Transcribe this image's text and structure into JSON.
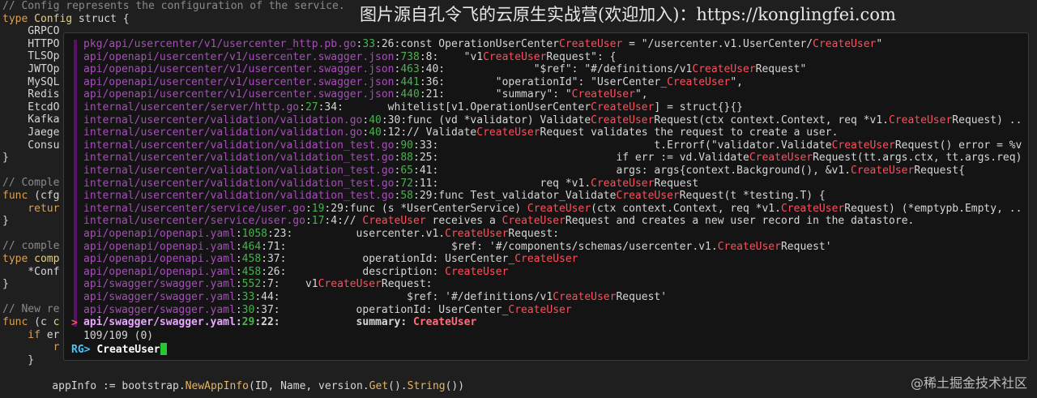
{
  "watermark": "图片源自孔令飞的云原生实战营(欢迎加入)：https://konglingfei.com",
  "corner_watermark": "@稀土掘金技术社区",
  "editor": {
    "lines": [
      [
        [
          "c",
          "// Config represents the configuration of the service."
        ]
      ],
      [
        [
          "k",
          "type "
        ],
        [
          "t",
          "Config"
        ],
        [
          "p",
          " struct {"
        ]
      ],
      [
        [
          "p",
          "    GRPCO"
        ]
      ],
      [
        [
          "p",
          "    HTTPO"
        ]
      ],
      [
        [
          "p",
          "    TLSOp"
        ]
      ],
      [
        [
          "p",
          "    JWTOp"
        ]
      ],
      [
        [
          "p",
          "    MySQL"
        ]
      ],
      [
        [
          "p",
          "    Redis"
        ]
      ],
      [
        [
          "p",
          "    EtcdO"
        ]
      ],
      [
        [
          "p",
          "    Kafka"
        ]
      ],
      [
        [
          "p",
          "    Jaege"
        ]
      ],
      [
        [
          "p",
          "    Consu"
        ]
      ],
      [
        [
          "p",
          "}"
        ]
      ],
      [
        [
          "p",
          ""
        ]
      ],
      [
        [
          "c",
          "// Comple"
        ]
      ],
      [
        [
          "k",
          "func "
        ],
        [
          "p",
          "(cfg"
        ]
      ],
      [
        [
          "k",
          "    retur"
        ]
      ],
      [
        [
          "p",
          "}"
        ]
      ],
      [
        [
          "p",
          ""
        ]
      ],
      [
        [
          "c",
          "// comple"
        ]
      ],
      [
        [
          "k",
          "type "
        ],
        [
          "t",
          "comp"
        ]
      ],
      [
        [
          "p",
          "    *Conf"
        ]
      ],
      [
        [
          "p",
          "}"
        ]
      ],
      [
        [
          "p",
          ""
        ]
      ],
      [
        [
          "c",
          "// New re"
        ]
      ],
      [
        [
          "k",
          "func "
        ],
        [
          "p",
          "(c "
        ],
        [
          "t",
          "c"
        ]
      ],
      [
        [
          "k",
          "    if "
        ],
        [
          "p",
          "er"
        ]
      ],
      [
        [
          "k",
          "        r"
        ]
      ],
      [
        [
          "p",
          "    }"
        ]
      ]
    ],
    "bottom_line": [
      [
        "p",
        "    appInfo := bootstrap."
      ],
      [
        "f",
        "NewAppInfo"
      ],
      [
        "p",
        "(ID, Name, version."
      ],
      [
        "f",
        "Get"
      ],
      [
        "p",
        "()."
      ],
      [
        "f",
        "String"
      ],
      [
        "p",
        "())"
      ]
    ]
  },
  "fzf": {
    "results": [
      [
        [
          "path",
          "pkg/api/usercenter/v1/usercenter_http.pb.go"
        ],
        [
          "p",
          ":"
        ],
        [
          "n",
          "33"
        ],
        [
          "p",
          ":26:const OperationUserCenter"
        ],
        [
          "m",
          "CreateUser"
        ],
        [
          "p",
          " = \"/usercenter.v1.UserCenter/"
        ],
        [
          "m",
          "CreateUser"
        ],
        [
          "p",
          "\""
        ]
      ],
      [
        [
          "path",
          "api/openapi/usercenter/v1/usercenter.swagger.json"
        ],
        [
          "p",
          ":"
        ],
        [
          "n",
          "738"
        ],
        [
          "p",
          ":8:    \"v1"
        ],
        [
          "m",
          "CreateUser"
        ],
        [
          "p",
          "Request\": {"
        ]
      ],
      [
        [
          "path",
          "api/openapi/usercenter/v1/usercenter.swagger.json"
        ],
        [
          "p",
          ":"
        ],
        [
          "n",
          "463"
        ],
        [
          "p",
          ":40:              \"$ref\": \"#/definitions/v1"
        ],
        [
          "m",
          "CreateUser"
        ],
        [
          "p",
          "Request\""
        ]
      ],
      [
        [
          "path",
          "api/openapi/usercenter/v1/usercenter.swagger.json"
        ],
        [
          "p",
          ":"
        ],
        [
          "n",
          "441"
        ],
        [
          "p",
          ":36:        \"operationId\": \"UserCenter_"
        ],
        [
          "m",
          "CreateUser"
        ],
        [
          "p",
          "\","
        ]
      ],
      [
        [
          "path",
          "api/openapi/usercenter/v1/usercenter.swagger.json"
        ],
        [
          "p",
          ":"
        ],
        [
          "n",
          "440"
        ],
        [
          "p",
          ":21:        \"summary\": \""
        ],
        [
          "m",
          "CreateUser"
        ],
        [
          "p",
          "\","
        ]
      ],
      [
        [
          "path",
          "internal/usercenter/server/http.go"
        ],
        [
          "p",
          ":"
        ],
        [
          "n",
          "27"
        ],
        [
          "p",
          ":34:       whitelist[v1.OperationUserCenter"
        ],
        [
          "m",
          "CreateUser"
        ],
        [
          "p",
          "] = struct{}{}"
        ]
      ],
      [
        [
          "path",
          "internal/usercenter/validation/validation.go"
        ],
        [
          "p",
          ":"
        ],
        [
          "n",
          "40"
        ],
        [
          "p",
          ":30:func (vd *validator) Validate"
        ],
        [
          "m",
          "CreateUser"
        ],
        [
          "p",
          "Request(ctx context.Context, req *v1."
        ],
        [
          "m",
          "CreateUser"
        ],
        [
          "p",
          "Request) .."
        ]
      ],
      [
        [
          "path",
          "internal/usercenter/validation/validation.go"
        ],
        [
          "p",
          ":"
        ],
        [
          "n",
          "40"
        ],
        [
          "p",
          ":12:// Validate"
        ],
        [
          "m",
          "CreateUser"
        ],
        [
          "p",
          "Request validates the request to create a user."
        ]
      ],
      [
        [
          "path",
          "internal/usercenter/validation/validation_test.go"
        ],
        [
          "p",
          ":"
        ],
        [
          "n",
          "90"
        ],
        [
          "p",
          ":33:                                  t.Errorf(\"validator.Validate"
        ],
        [
          "m",
          "CreateUser"
        ],
        [
          "p",
          "Request() error = %v.."
        ]
      ],
      [
        [
          "path",
          "internal/usercenter/validation/validation_test.go"
        ],
        [
          "p",
          ":"
        ],
        [
          "n",
          "88"
        ],
        [
          "p",
          ":25:                            if err := vd.Validate"
        ],
        [
          "m",
          "CreateUser"
        ],
        [
          "p",
          "Request(tt.args.ctx, tt.args.req); .."
        ]
      ],
      [
        [
          "path",
          "internal/usercenter/validation/validation_test.go"
        ],
        [
          "p",
          ":"
        ],
        [
          "n",
          "65"
        ],
        [
          "p",
          ":41:                            args: args{context.Background(), &v1."
        ],
        [
          "m",
          "CreateUser"
        ],
        [
          "p",
          "Request{"
        ]
      ],
      [
        [
          "path",
          "internal/usercenter/validation/validation_test.go"
        ],
        [
          "p",
          ":"
        ],
        [
          "n",
          "72"
        ],
        [
          "p",
          ":11:                req *v1."
        ],
        [
          "m",
          "CreateUser"
        ],
        [
          "p",
          "Request"
        ]
      ],
      [
        [
          "path",
          "internal/usercenter/validation/validation_test.go"
        ],
        [
          "p",
          ":"
        ],
        [
          "n",
          "58"
        ],
        [
          "p",
          ":29:func Test_validator_Validate"
        ],
        [
          "m",
          "CreateUser"
        ],
        [
          "p",
          "Request(t *testing.T) {"
        ]
      ],
      [
        [
          "path",
          "internal/usercenter/service/user.go"
        ],
        [
          "p",
          ":"
        ],
        [
          "n",
          "19"
        ],
        [
          "p",
          ":29:func (s *UserCenterService) "
        ],
        [
          "m",
          "CreateUser"
        ],
        [
          "p",
          "(ctx context.Context, req *v1."
        ],
        [
          "m",
          "CreateUser"
        ],
        [
          "p",
          "Request) (*emptypb.Empty, .."
        ]
      ],
      [
        [
          "path",
          "internal/usercenter/service/user.go"
        ],
        [
          "p",
          ":"
        ],
        [
          "n",
          "17"
        ],
        [
          "p",
          ":4:// "
        ],
        [
          "m",
          "CreateUser"
        ],
        [
          "p",
          " receives a "
        ],
        [
          "m",
          "CreateUser"
        ],
        [
          "p",
          "Request and creates a new user record in the datastore."
        ]
      ],
      [
        [
          "path",
          "api/openapi/openapi.yaml"
        ],
        [
          "p",
          ":"
        ],
        [
          "n",
          "1058"
        ],
        [
          "p",
          ":23:          usercenter.v1."
        ],
        [
          "m",
          "CreateUser"
        ],
        [
          "p",
          "Request:"
        ]
      ],
      [
        [
          "path",
          "api/openapi/openapi.yaml"
        ],
        [
          "p",
          ":"
        ],
        [
          "n",
          "464"
        ],
        [
          "p",
          ":71:                          $ref: '#/components/schemas/usercenter.v1."
        ],
        [
          "m",
          "CreateUser"
        ],
        [
          "p",
          "Request'"
        ]
      ],
      [
        [
          "path",
          "api/openapi/openapi.yaml"
        ],
        [
          "p",
          ":"
        ],
        [
          "n",
          "458"
        ],
        [
          "p",
          ":37:            operationId: UserCenter_"
        ],
        [
          "m",
          "CreateUser"
        ]
      ],
      [
        [
          "path",
          "api/openapi/openapi.yaml"
        ],
        [
          "p",
          ":"
        ],
        [
          "n",
          "458"
        ],
        [
          "p",
          ":26:            description: "
        ],
        [
          "m",
          "CreateUser"
        ]
      ],
      [
        [
          "path",
          "api/swagger/swagger.yaml"
        ],
        [
          "p",
          ":"
        ],
        [
          "n",
          "552"
        ],
        [
          "p",
          ":7:    v1"
        ],
        [
          "m",
          "CreateUser"
        ],
        [
          "p",
          "Request:"
        ]
      ],
      [
        [
          "path",
          "api/swagger/swagger.yaml"
        ],
        [
          "p",
          ":"
        ],
        [
          "n",
          "33"
        ],
        [
          "p",
          ":44:                    $ref: '#/definitions/v1"
        ],
        [
          "m",
          "CreateUser"
        ],
        [
          "p",
          "Request'"
        ]
      ],
      [
        [
          "path",
          "api/swagger/swagger.yaml"
        ],
        [
          "p",
          ":"
        ],
        [
          "n",
          "30"
        ],
        [
          "p",
          ":37:            operationId: UserCenter_"
        ],
        [
          "m",
          "CreateUser"
        ]
      ],
      [
        [
          "path",
          "api/swagger/swagger.yaml"
        ],
        [
          "p",
          ":"
        ],
        [
          "n",
          "29"
        ],
        [
          "p",
          ":22:            summary: "
        ],
        [
          "m",
          "CreateUser"
        ]
      ]
    ],
    "selected_index": 22,
    "marker": ">",
    "count": "109/109 (0)",
    "prompt": "RG>",
    "query": "CreateUser"
  },
  "colors": {
    "path": "#a64fb8",
    "line_number": "#4caf50",
    "match": "#ff4e5c",
    "prompt": "#4fc3f7",
    "cursor": "#25c832"
  }
}
